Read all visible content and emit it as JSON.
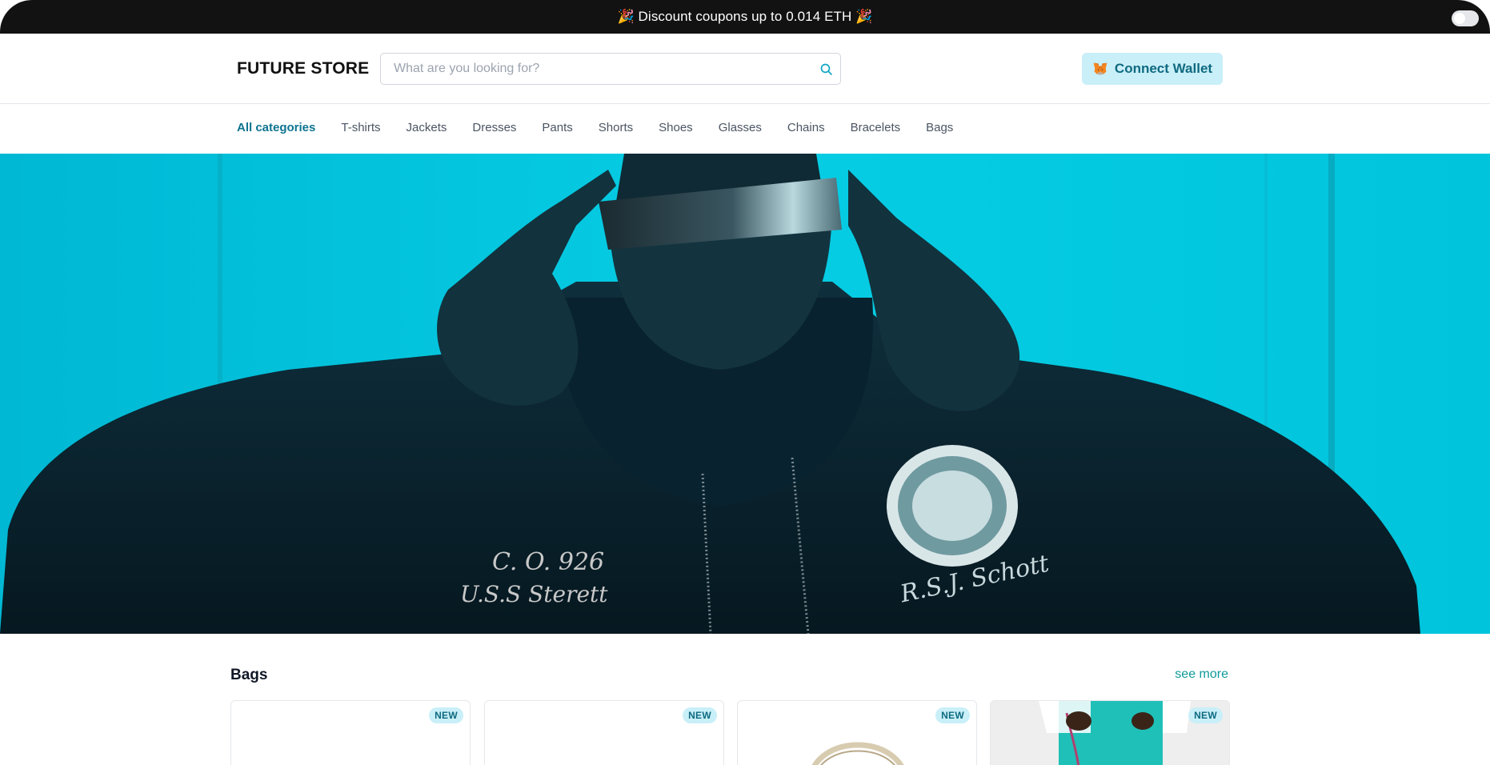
{
  "promo": {
    "text": "🎉 Discount coupons up to 0.014 ETH 🎉"
  },
  "header": {
    "logo": "FUTURE STORE",
    "search_placeholder": "What are you looking for?",
    "connect_label": "Connect Wallet"
  },
  "categories": [
    "All categories",
    "T-shirts",
    "Jackets",
    "Dresses",
    "Pants",
    "Shorts",
    "Shoes",
    "Glasses",
    "Chains",
    "Bracelets",
    "Bags"
  ],
  "active_category": "All categories",
  "section": {
    "title": "Bags",
    "see_more": "see more",
    "products": [
      {
        "badge": "NEW"
      },
      {
        "badge": "NEW"
      },
      {
        "badge": "NEW"
      },
      {
        "badge": "NEW"
      }
    ]
  },
  "colors": {
    "accent": "#0e7490",
    "hero_bg": "#00c9e0",
    "button_bg": "#c9eff8",
    "promo_bg": "#121212"
  },
  "icons": [
    "party-popper-icon",
    "search-icon",
    "metamask-fox-icon"
  ]
}
